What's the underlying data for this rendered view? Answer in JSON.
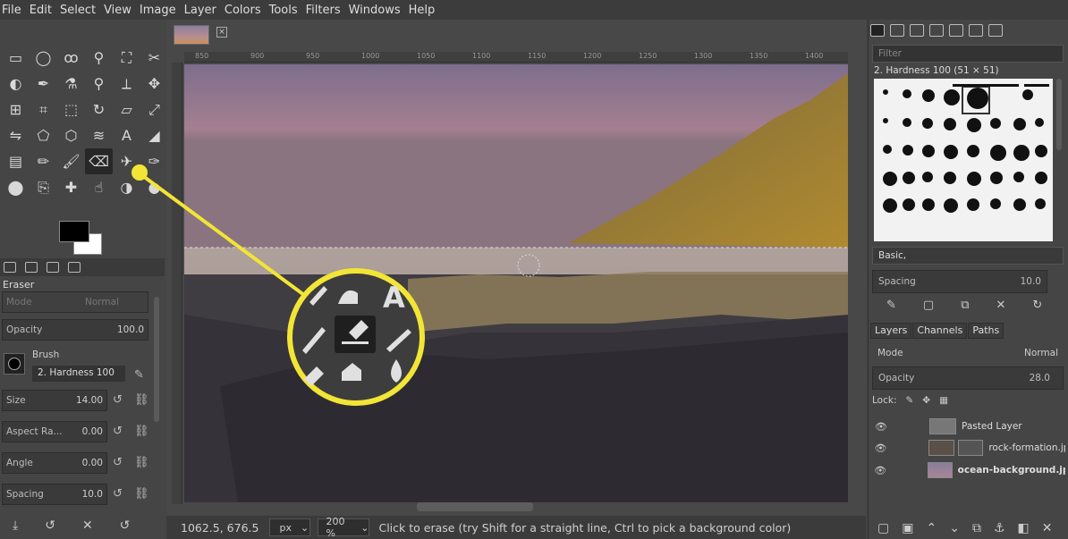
{
  "menu": [
    "File",
    "Edit",
    "Select",
    "View",
    "Image",
    "Layer",
    "Colors",
    "Tools",
    "Filters",
    "Windows",
    "Help"
  ],
  "toolbox": {
    "tools": [
      "rect-select",
      "ellipse-select",
      "free-select",
      "fuzzy-select",
      "by-color-select",
      "scissors-select",
      "foreground-select",
      "paths",
      "color-picker",
      "zoom",
      "measure",
      "move",
      "align",
      "crop",
      "unified-transform",
      "rotate",
      "shear",
      "scale",
      "flip",
      "perspective",
      "cage-transform",
      "warp",
      "text",
      "bucket-fill",
      "gradient",
      "pencil",
      "paintbrush",
      "eraser",
      "airbrush",
      "ink",
      "mypaint-brush",
      "clone",
      "heal",
      "smudge",
      "dodge-burn",
      "blur"
    ],
    "selected_tool": "eraser",
    "tool_options": {
      "title": "Eraser",
      "mode_label": "Mode",
      "mode_value": "Normal",
      "opacity_label": "Opacity",
      "opacity_value": "100.0",
      "brush_label": "Brush",
      "brush_value": "2. Hardness 100",
      "size_label": "Size",
      "size_value": "14.00",
      "aspect_label": "Aspect Ra...",
      "aspect_value": "0.00",
      "angle_label": "Angle",
      "angle_value": "0.00",
      "spacing_label": "Spacing",
      "spacing_value": "10.0"
    }
  },
  "canvas": {
    "ruler_marks": [
      "850",
      "900",
      "950",
      "1000",
      "1050",
      "1100",
      "1150",
      "1200",
      "1250",
      "1300",
      "1350",
      "1400"
    ],
    "status": {
      "coords": "1062.5, 676.5",
      "unit": "px",
      "zoom": "200 %",
      "message": "Click to erase (try Shift for a straight line, Ctrl to pick a background color)"
    }
  },
  "brushes": {
    "filter_placeholder": "Filter",
    "selected_brush": "2. Hardness 100 (51 × 51)",
    "tag": "Basic,",
    "spacing_label": "Spacing",
    "spacing_value": "10.0"
  },
  "layers": {
    "tabs": [
      "Layers",
      "Channels",
      "Paths"
    ],
    "mode_label": "Mode",
    "mode_value": "Normal",
    "opacity_label": "Opacity",
    "opacity_value": "28.0",
    "lock_label": "Lock:",
    "items": [
      {
        "name": "Pasted Layer"
      },
      {
        "name": "rock-formation.jp"
      },
      {
        "name": "ocean-background.jpg"
      }
    ]
  },
  "colors": {
    "highlight": "#f2e536",
    "background": "#454545"
  }
}
